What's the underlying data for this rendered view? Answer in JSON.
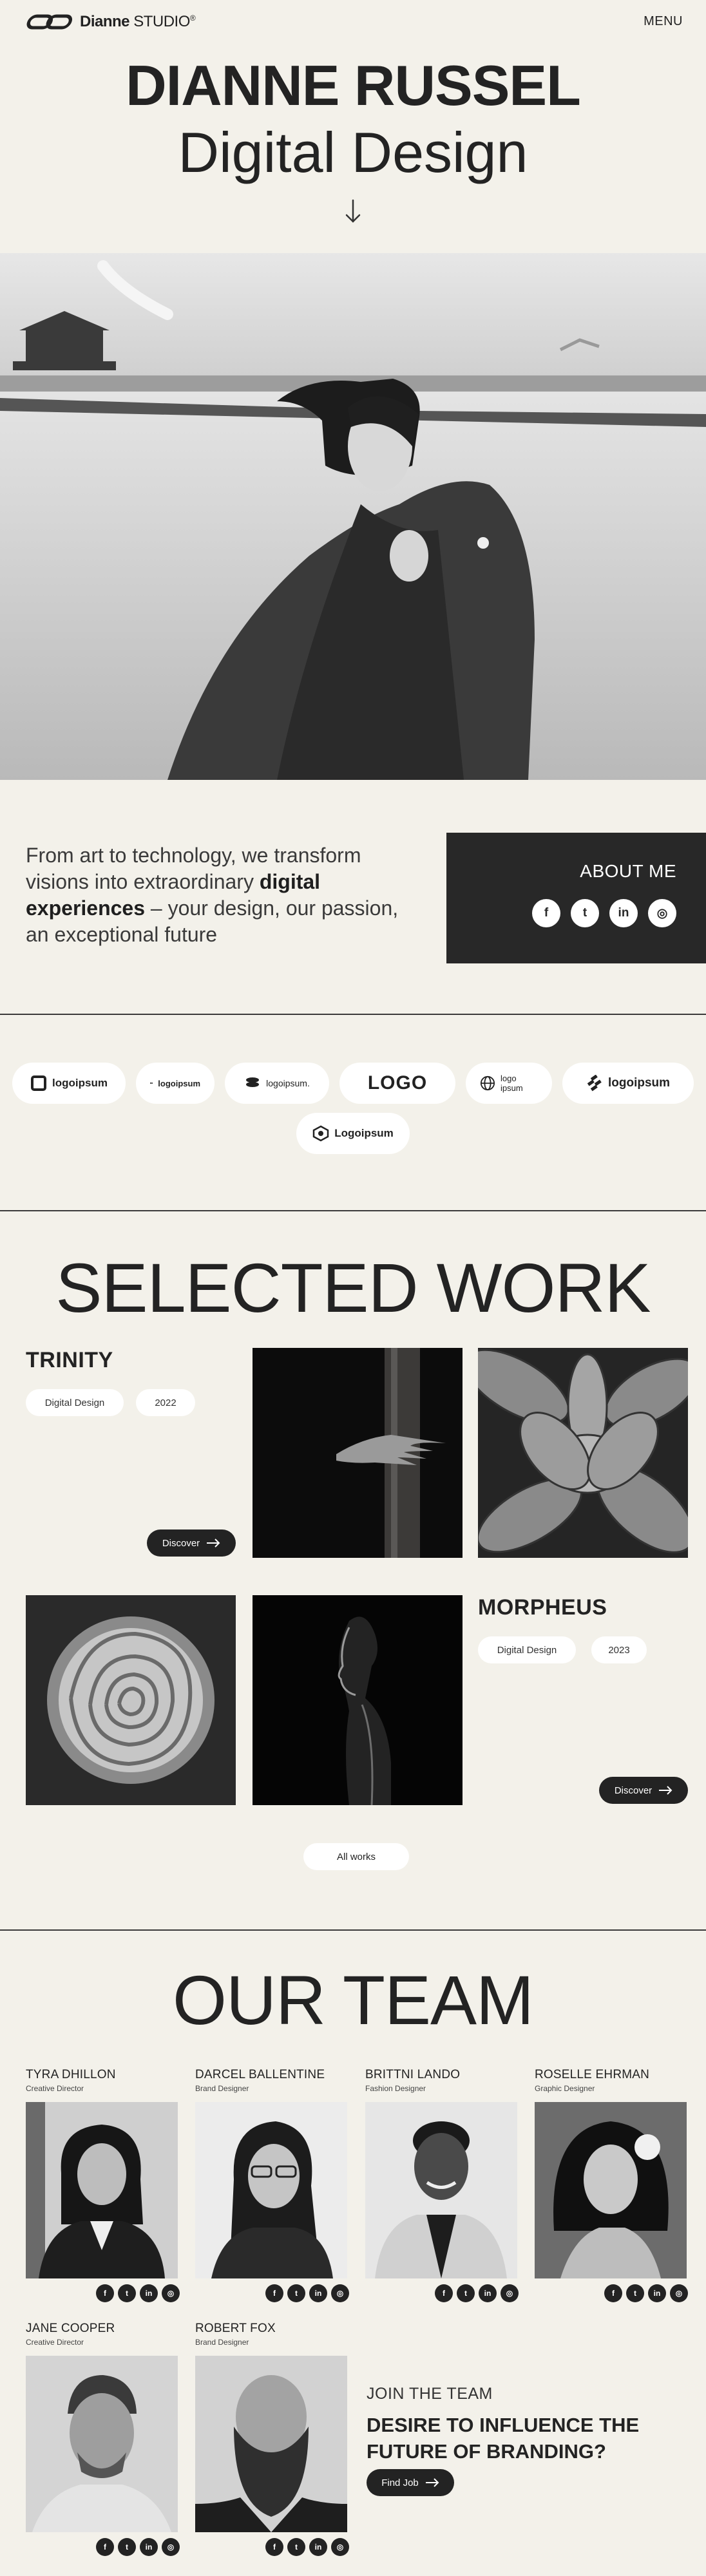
{
  "header": {
    "brand_bold": "Dianne",
    "brand_light": "STUDIO",
    "brand_mark": "®",
    "menu_label": "MENU"
  },
  "hero": {
    "name": "DIANNE RUSSEL",
    "subtitle": "Digital Design",
    "scroll_icon": "arrow-down-icon"
  },
  "intro": {
    "text_before": "From art to technology, we transform visions into extraordinary ",
    "text_bold": "digital experiences",
    "text_after": " – your design, our passion, an exceptional future",
    "about_label": "ABOUT ME",
    "socials": [
      {
        "icon": "facebook-icon",
        "glyph": "f"
      },
      {
        "icon": "twitter-icon",
        "glyph": "t"
      },
      {
        "icon": "linkedin-icon",
        "glyph": "in"
      },
      {
        "icon": "dribbble-icon",
        "glyph": "◎"
      }
    ]
  },
  "partners": [
    {
      "label": "logoipsum"
    },
    {
      "label": "logoipsum"
    },
    {
      "label": "logoipsum."
    },
    {
      "label": "LOGO"
    },
    {
      "label": "logo ipsum"
    },
    {
      "label": "logoipsum"
    },
    {
      "label": "Logoipsum"
    }
  ],
  "work": {
    "title": "SELECTED WORK",
    "projects": [
      {
        "title": "TRINITY",
        "tags": [
          "Digital Design",
          "2022"
        ],
        "cta": "Discover"
      },
      {
        "title": "MORPHEUS",
        "tags": [
          "Digital Design",
          "2023"
        ],
        "cta": "Discover"
      }
    ],
    "all_label": "All works"
  },
  "team": {
    "title": "OUR TEAM",
    "members": [
      {
        "name": "TYRA DHILLON",
        "role": "Creative Director"
      },
      {
        "name": "DARCEL BALLENTINE",
        "role": "Brand Designer"
      },
      {
        "name": "BRITTNI LANDO",
        "role": "Fashion Designer"
      },
      {
        "name": "ROSELLE EHRMAN",
        "role": "Graphic Designer"
      },
      {
        "name": "JANE COOPER",
        "role": "Creative Director"
      },
      {
        "name": "ROBERT FOX",
        "role": "Brand Designer"
      }
    ],
    "join_label": "JOIN THE TEAM",
    "join_heading": "DESIRE TO INFLUENCE THE FUTURE OF BRANDING?",
    "join_cta": "Find Job"
  }
}
